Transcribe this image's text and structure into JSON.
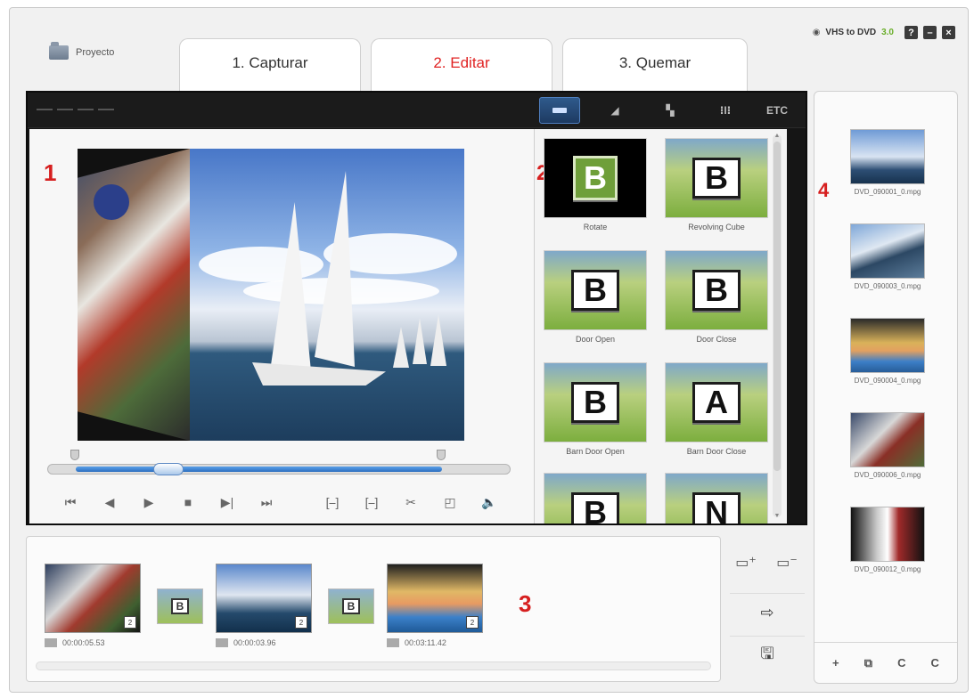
{
  "header": {
    "project_label": "Proyecto",
    "tabs": [
      {
        "label": "1. Capturar"
      },
      {
        "label": "2. Editar"
      },
      {
        "label": "3. Quemar"
      }
    ],
    "app_name": "VHS to DVD",
    "app_version": "3.0",
    "window_buttons": [
      "?",
      "–",
      "×"
    ]
  },
  "toolbar": {
    "etc_label": "ETC",
    "buttons": [
      "transition-icon",
      "effect-icon",
      "split-icon",
      "text-icon"
    ]
  },
  "markers": {
    "one": "1",
    "two": "2",
    "three": "3",
    "four": "4"
  },
  "effects": [
    {
      "label": "Rotate"
    },
    {
      "label": "Revolving Cube"
    },
    {
      "label": "Door Open"
    },
    {
      "label": "Door Close"
    },
    {
      "label": "Barn Door Open"
    },
    {
      "label": "Barn Door Close"
    },
    {
      "label": ""
    },
    {
      "label": ""
    }
  ],
  "effect_letters": {
    "a": "B",
    "b": "B",
    "c": "B",
    "d": "B",
    "e": "B",
    "f": "A",
    "g": "B",
    "h": "N"
  },
  "library": {
    "clips": [
      {
        "label": "DVD_090001_0.mpg"
      },
      {
        "label": "DVD_090003_0.mpg"
      },
      {
        "label": "DVD_090004_0.mpg"
      },
      {
        "label": "DVD_090006_0.mpg"
      },
      {
        "label": "DVD_090012_0.mpg"
      }
    ],
    "tools": [
      "+",
      "⧉",
      "C",
      "C"
    ]
  },
  "storyboard": {
    "clips": [
      {
        "time": "00:00:05.53"
      },
      {
        "time": "00:00:03.96"
      },
      {
        "time": "00:03:11.42"
      }
    ],
    "transition_letters": [
      "B",
      "B"
    ],
    "badge": "2"
  },
  "colors": {
    "accent_red": "#e02323",
    "version_green": "#6aae2a",
    "scrub_blue": "#2d6fc0"
  },
  "playback": {
    "position_fraction": 0.26,
    "trim_start_fraction": 0.06,
    "trim_end_fraction": 0.85
  }
}
